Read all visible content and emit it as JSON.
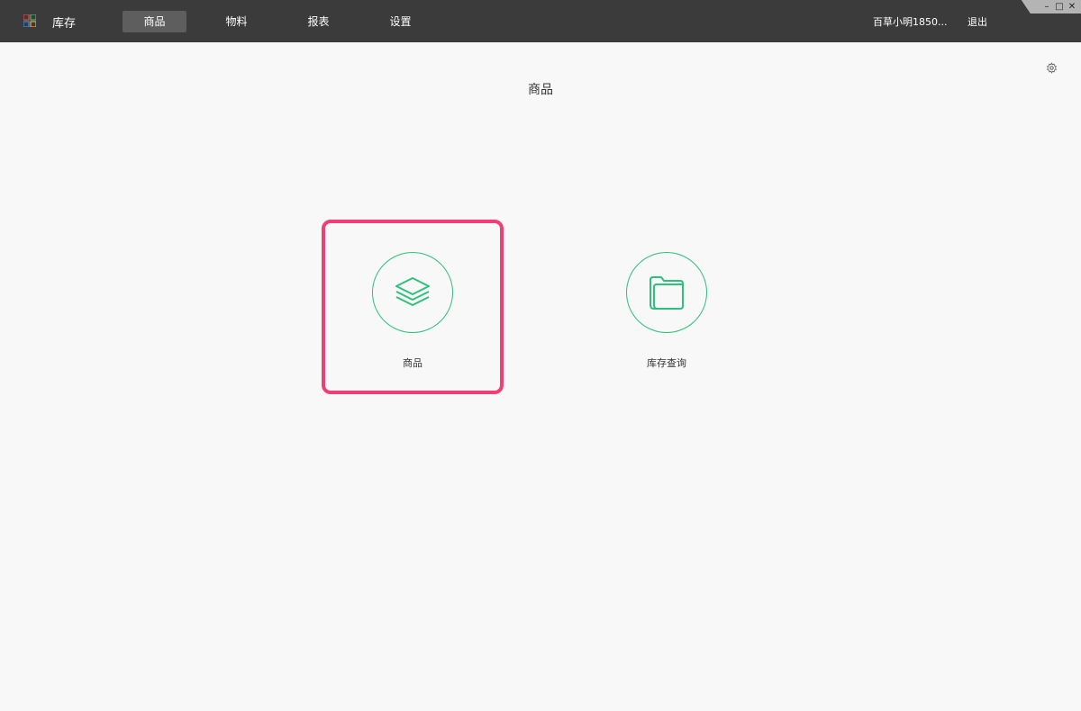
{
  "topbar": {
    "app_title": "库存",
    "nav": [
      {
        "label": "商品",
        "active": true
      },
      {
        "label": "物料",
        "active": false
      },
      {
        "label": "报表",
        "active": false
      },
      {
        "label": "设置",
        "active": false
      }
    ],
    "user": "百草小明1850...",
    "logout": "退出"
  },
  "window_controls": {
    "minimize": "–",
    "maximize": "□",
    "close": "✕"
  },
  "page": {
    "title": "商品"
  },
  "cards": [
    {
      "label": "商品",
      "icon": "layers-icon",
      "selected": true
    },
    {
      "label": "库存查询",
      "icon": "folder-icon",
      "selected": false
    }
  ],
  "colors": {
    "accent": "#2fc07a",
    "highlight": "#f13f73",
    "topbar": "#3b3b3b"
  }
}
